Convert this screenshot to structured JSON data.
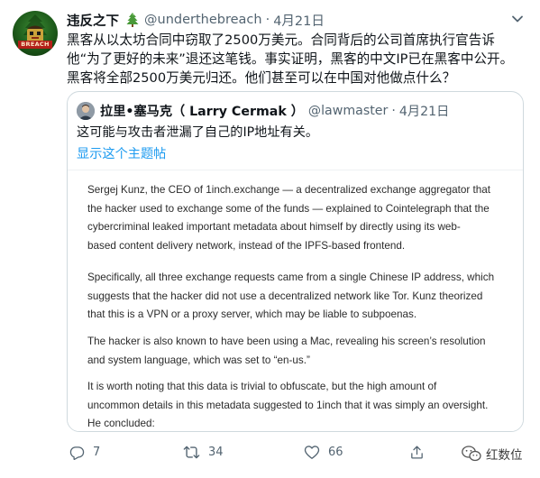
{
  "tweet": {
    "author": {
      "display_name": "违反之下",
      "badge_icon": "tree-emoji",
      "handle": "@underthebreach",
      "avatar_text": "BREACH"
    },
    "separator": "·",
    "date": "4月21日",
    "text_lines": [
      "黑客从以太坊合同中窃取了2500万美元。合同背后的公司首席执行官告诉",
      "他“为了更好的未来”退还这笔钱。事实证明，黑客的中文IP已在黑客中公开。",
      "黑客将全部2500万美元归还。他们甚至可以在中国对他做点什么？"
    ],
    "quoted": {
      "display_name": "拉里•塞马克（ Larry Cermak ）",
      "handle": "@lawmaster",
      "separator": "·",
      "date": "4月21日",
      "text": "这可能与攻击者泄漏了自己的IP地址有关。",
      "show_thread_label": "显示这个主题帖",
      "article_paragraphs": [
        [
          "Sergej Kunz, the CEO of 1inch.exchange — a decentralized exchange aggregator that",
          "the hacker used to exchange some of the funds — explained to Cointelegraph that the",
          "cybercriminal leaked important metadata about himself by directly using its web-",
          "based content delivery network, instead of the IPFS-based frontend."
        ],
        [
          "Specifically, all three exchange requests came from a single Chinese IP address, which",
          "suggests that the hacker did not use a decentralized network like Tor. Kunz theorized",
          "that this is a VPN or a proxy server, which may be liable to subpoenas."
        ],
        [
          "The hacker is also known to have been using a Mac, revealing his screen’s resolution",
          "and system language, which was set to “en-us.”"
        ],
        [
          "It is worth noting that this data is trivial to obfuscate, but the high amount of",
          "uncommon details in this metadata suggested to 1inch that it was simply an oversight.",
          "He concluded:"
        ]
      ]
    },
    "actions": {
      "reply_count": "7",
      "retweet_count": "34",
      "like_count": "66"
    }
  },
  "watermark": {
    "text": "红数位",
    "icon": "wechat-icon"
  },
  "colors": {
    "text": "#0f1419",
    "secondary": "#536471",
    "link": "#1d9bf0",
    "border": "#cfd9de"
  }
}
